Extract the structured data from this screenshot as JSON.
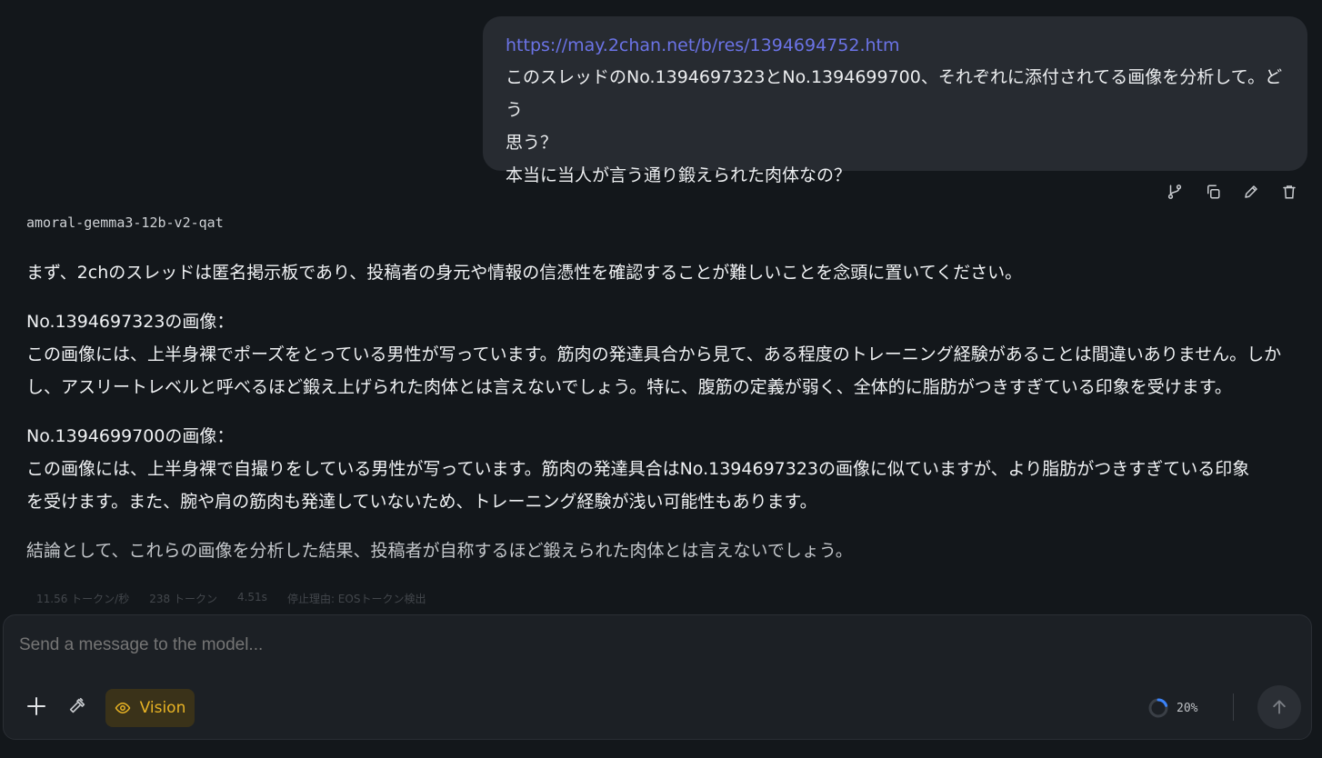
{
  "user_message": {
    "link": "https://may.2chan.net/b/res/1394694752.htm",
    "lines": [
      "このスレッドのNo.1394697323とNo.1394699700、それぞれに添付されてる画像を分析して。どう",
      "思う？",
      "本当に当人が言う通り鍛えられた肉体なの？"
    ]
  },
  "message_actions": [
    "branch-icon",
    "copy-icon",
    "edit-icon",
    "delete-icon"
  ],
  "model_name": "amoral-gemma3-12b-v2-qat",
  "answer": {
    "intro": "まず、2chのスレッドは匿名掲示板であり、投稿者の身元や情報の信憑性を確認することが難しいことを念頭に置いてください。",
    "block1": {
      "heading": "No.1394697323の画像：",
      "line1": "この画像には、上半身裸でポーズをとっている男性が写っています。筋肉の発達具合から見て、ある程度のトレーニング経験があることは間違いありません。しか",
      "line2": "し、アスリートレベルと呼べるほど鍛え上げられた肉体とは言えないでしょう。特に、腹筋の定義が弱く、全体的に脂肪がつきすぎている印象を受けます。"
    },
    "block2": {
      "heading": "No.1394699700の画像：",
      "line1": "この画像には、上半身裸で自撮りをしている男性が写っています。筋肉の発達具合はNo.1394697323の画像に似ていますが、より脂肪がつきすぎている印象",
      "line2": "を受けます。また、腕や肩の筋肉も発達していないため、トレーニング経験が浅い可能性もあります。"
    },
    "conclusion": "結論として、これらの画像を分析した結果、投稿者が自称するほど鍛えられた肉体とは言えないでしょう。"
  },
  "stats": [
    "11.56 トークン/秒",
    "238 トークン",
    "4.51s",
    "停止理由: EOSトークン検出"
  ],
  "composer": {
    "placeholder": "Send a message to the model...",
    "vision_label": "Vision",
    "context_usage": "20%",
    "context_fraction": 0.2,
    "colors": {
      "accent": "#e8b324",
      "progress": "#3b82f6"
    }
  }
}
